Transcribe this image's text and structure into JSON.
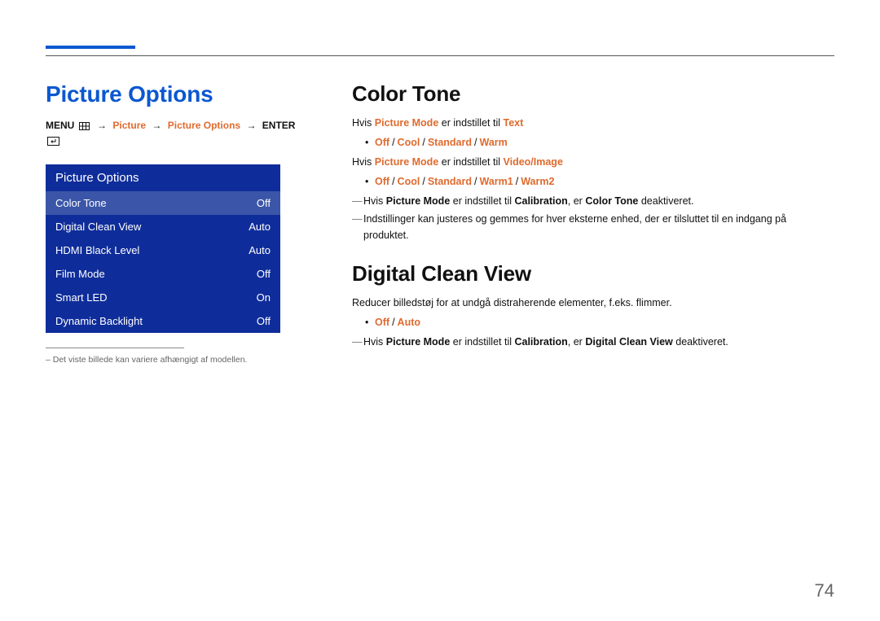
{
  "page_number": "74",
  "left": {
    "heading": "Picture Options",
    "breadcrumb": {
      "menu": "MENU",
      "parts": [
        "Picture",
        "Picture Options"
      ],
      "enter": "ENTER"
    },
    "osd": {
      "title": "Picture Options",
      "rows": [
        {
          "label": "Color Tone",
          "value": "Off",
          "selected": true
        },
        {
          "label": "Digital Clean View",
          "value": "Auto",
          "selected": false
        },
        {
          "label": "HDMI Black Level",
          "value": "Auto",
          "selected": false
        },
        {
          "label": "Film Mode",
          "value": "Off",
          "selected": false
        },
        {
          "label": "Smart LED",
          "value": "On",
          "selected": false
        },
        {
          "label": "Dynamic Backlight",
          "value": "Off",
          "selected": false
        }
      ]
    },
    "footnote": "–  Det viste billede kan variere afhængigt af modellen."
  },
  "right": {
    "color_tone": {
      "heading": "Color Tone",
      "line1_pre": "Hvis ",
      "line1_accent": "Picture Mode",
      "line1_mid": " er indstillet til ",
      "line1_end": "Text",
      "bullets1": [
        "Off",
        "Cool",
        "Standard",
        "Warm"
      ],
      "line2_pre": "Hvis ",
      "line2_accent": "Picture Mode",
      "line2_mid": " er indstillet til ",
      "line2_end": "Video/Image",
      "bullets2": [
        "Off",
        "Cool",
        "Standard",
        "Warm1",
        "Warm2"
      ],
      "dash1_pre": "Hvis ",
      "dash1_a1": "Picture Mode",
      "dash1_mid1": " er indstillet til ",
      "dash1_a2": "Calibration",
      "dash1_mid2": ", er ",
      "dash1_a3": "Color Tone",
      "dash1_end": " deaktiveret.",
      "dash2": "Indstillinger kan justeres og gemmes for hver eksterne enhed, der er tilsluttet til en indgang på produktet."
    },
    "dcv": {
      "heading": "Digital Clean View",
      "line": "Reducer billedstøj for at undgå distraherende elementer, f.eks. flimmer.",
      "bullets": [
        "Off",
        "Auto"
      ],
      "dash_pre": "Hvis ",
      "dash_a1": "Picture Mode",
      "dash_mid1": " er indstillet til ",
      "dash_a2": "Calibration",
      "dash_mid2": ", er ",
      "dash_a3": "Digital Clean View",
      "dash_end": " deaktiveret."
    }
  }
}
